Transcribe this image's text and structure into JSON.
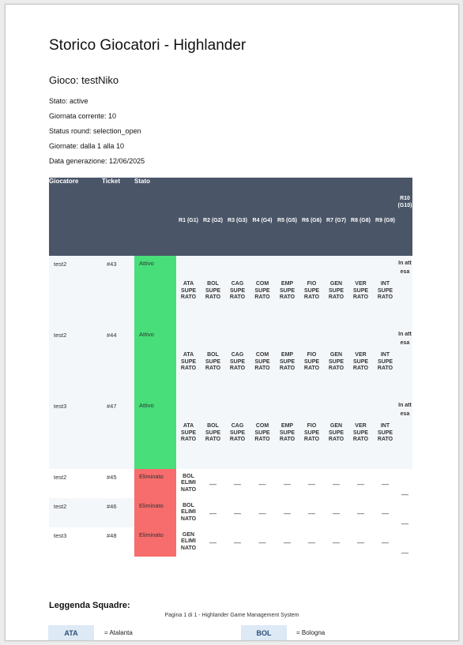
{
  "title": "Storico Giocatori - Highlander",
  "game": "Gioco: testNiko",
  "info": {
    "stato": "Stato: active",
    "giornata": "Giornata corrente: 10",
    "status_round": "Status round: selection_open",
    "giornate": "Giornate: dalla 1 alla 10",
    "data": "Data generazione: 12/06/2025"
  },
  "table": {
    "headers": {
      "player": "Giocatore",
      "ticket": "Ticket",
      "status": "Stato",
      "rounds": [
        "R1 (G1)",
        "R2 (G2)",
        "R3 (G3)",
        "R4 (G4)",
        "R5 (G5)",
        "R6 (G6)",
        "R7 (G7)",
        "R8 (G8)",
        "R9 (G9)"
      ],
      "r10": "R10 (G10)"
    },
    "rows": [
      {
        "player": "test2",
        "ticket": "#43",
        "status": "Attivo",
        "rounds": [
          "ATA SUPE RATO",
          "BOL SUPE RATO",
          "CAG SUPE RATO",
          "COM SUPE RATO",
          "EMP SUPE RATO",
          "FIO SUPE RATO",
          "GEN SUPE RATO",
          "VER SUPE RATO",
          "INT SUPE RATO"
        ],
        "r10": "In attesa"
      },
      {
        "player": "test2",
        "ticket": "#44",
        "status": "Attivo",
        "rounds": [
          "ATA SUPE RATO",
          "BOL SUPE RATO",
          "CAG SUPE RATO",
          "COM SUPE RATO",
          "EMP SUPE RATO",
          "FIO SUPE RATO",
          "GEN SUPE RATO",
          "VER SUPE RATO",
          "INT SUPE RATO"
        ],
        "r10": "In attesa"
      },
      {
        "player": "test3",
        "ticket": "#47",
        "status": "Attivo",
        "rounds": [
          "ATA SUPE RATO",
          "BOL SUPE RATO",
          "CAG SUPE RATO",
          "COM SUPE RATO",
          "EMP SUPE RATO",
          "FIO SUPE RATO",
          "GEN SUPE RATO",
          "VER SUPE RATO",
          "INT SUPE RATO"
        ],
        "r10": "In attesa"
      },
      {
        "player": "test2",
        "ticket": "#45",
        "status": "Eliminato",
        "rounds": [
          "BOL ELIMI NATO",
          "—",
          "—",
          "—",
          "—",
          "—",
          "—",
          "—",
          "—"
        ],
        "r10": "—"
      },
      {
        "player": "test2",
        "ticket": "#46",
        "status": "Eliminato",
        "rounds": [
          "BOL ELIMI NATO",
          "—",
          "—",
          "—",
          "—",
          "—",
          "—",
          "—",
          "—"
        ],
        "r10": "—"
      },
      {
        "player": "test3",
        "ticket": "#48",
        "status": "Eliminato",
        "rounds": [
          "GEN ELIMI NATO",
          "—",
          "—",
          "—",
          "—",
          "—",
          "—",
          "—",
          "—"
        ],
        "r10": "—"
      }
    ]
  },
  "legend": {
    "title": "Leggenda Squadre:",
    "items": [
      {
        "code": "ATA",
        "name": "= Atalanta"
      },
      {
        "code": "BOL",
        "name": "= Bologna"
      }
    ]
  },
  "footer": "Pagina 1 di 1 - Highlander Game Management System",
  "colors": {
    "header_bg": "#4a5568",
    "active_status": "#48de7a",
    "eliminated_status": "#f76c6c",
    "legend_code_bg": "#dde9f5"
  }
}
